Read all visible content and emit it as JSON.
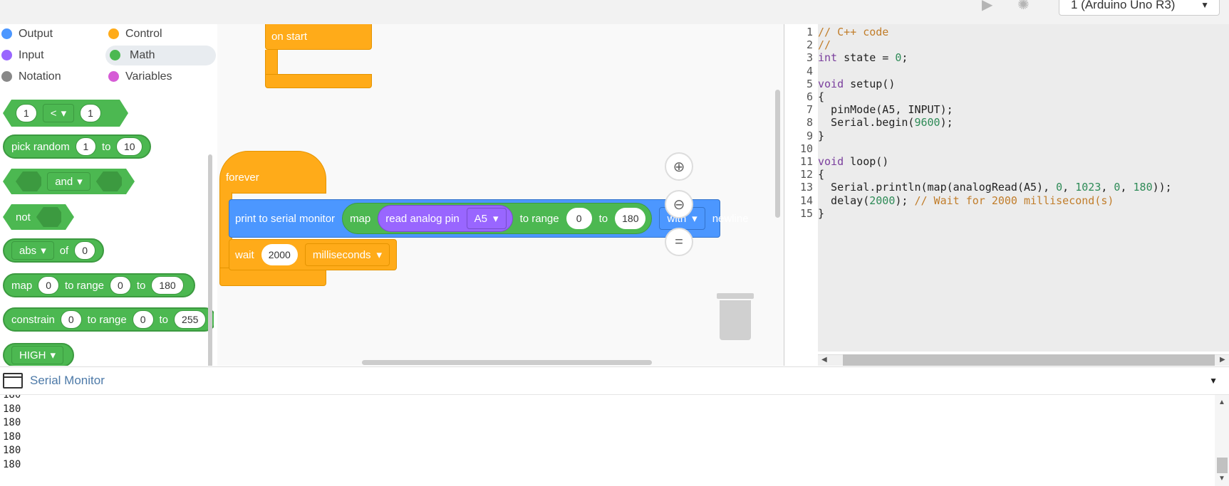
{
  "topbar": {
    "board": "1 (Arduino Uno R3)"
  },
  "categories": [
    {
      "label": "Output",
      "color": "#4c97ff"
    },
    {
      "label": "Control",
      "color": "#ffab19"
    },
    {
      "label": "Input",
      "color": "#9966ff"
    },
    {
      "label": "Math",
      "color": "#4cb851"
    },
    {
      "label": "Notation",
      "color": "#888888"
    },
    {
      "label": "Variables",
      "color": "#d65cd6"
    }
  ],
  "palette": {
    "compare": {
      "left": "1",
      "op": "<",
      "right": "1"
    },
    "random": {
      "label": "pick random",
      "from": "1",
      "to_label": "to",
      "to": "10"
    },
    "and": {
      "label": "and"
    },
    "not": {
      "label": "not"
    },
    "abs": {
      "fn": "abs",
      "of_label": "of",
      "value": "0"
    },
    "map": {
      "label": "map",
      "value": "0",
      "range_label": "to range",
      "low": "0",
      "to_label": "to",
      "high": "180"
    },
    "constrain": {
      "label": "constrain",
      "value": "0",
      "range_label": "to range",
      "low": "0",
      "to_label": "to",
      "high": "255"
    },
    "high": {
      "label": "HIGH"
    }
  },
  "canvas": {
    "on_start": "on start",
    "forever": "forever",
    "print_label": "print to serial monitor",
    "map_label": "map",
    "read_label": "read analog pin",
    "pin": "A5",
    "range_label": "to range",
    "low": "0",
    "to_label": "to",
    "high": "180",
    "with_label": "with",
    "newline": "newline",
    "wait_label": "wait",
    "wait_value": "2000",
    "unit": "milliseconds"
  },
  "code_lines": [
    "// C++ code",
    "//",
    "int state = 0;",
    "",
    "void setup()",
    "{",
    "  pinMode(A5, INPUT);",
    "  Serial.begin(9600);",
    "}",
    "",
    "void loop()",
    "{",
    "  Serial.println(map(analogRead(A5), 0, 1023, 0, 180));",
    "  delay(2000); // Wait for 2000 millisecond(s)",
    "}"
  ],
  "serial": {
    "title": "Serial Monitor",
    "lines": [
      "180",
      "180",
      "180",
      "180",
      "180",
      "180"
    ]
  }
}
